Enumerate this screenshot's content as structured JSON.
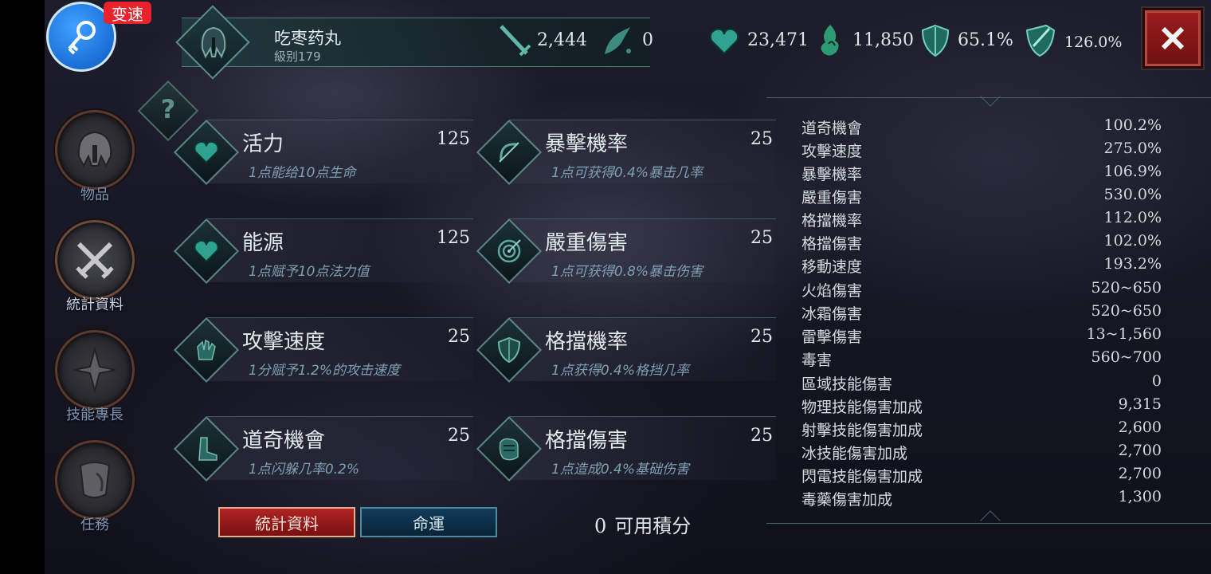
{
  "speed_badge": "变速",
  "nav": [
    {
      "label": "物品",
      "icon": "helmet-icon"
    },
    {
      "label": "統計資料",
      "icon": "crossed-swords-icon"
    },
    {
      "label": "技能專長",
      "icon": "skill-star-icon"
    },
    {
      "label": "任務",
      "icon": "quest-scroll-icon"
    }
  ],
  "header": {
    "name": "吃枣药丸",
    "level": "級别179",
    "damage": "2,444",
    "secondary": "0",
    "health": "23,471",
    "mana": "11,850",
    "armor": "65.1%",
    "resist": "126.0%"
  },
  "attributes": [
    {
      "name": "活力",
      "value": "125",
      "desc": "1点能给10点生命",
      "icon": "heart-icon"
    },
    {
      "name": "能源",
      "value": "125",
      "desc": "1点赋予10点法力值",
      "icon": "heart-icon"
    },
    {
      "name": "攻擊速度",
      "value": "25",
      "desc": "1分赋予1.2%的攻击速度",
      "icon": "gauntlet-icon"
    },
    {
      "name": "道奇機會",
      "value": "25",
      "desc": "1点闪躲几率0.2%",
      "icon": "boot-icon"
    },
    {
      "name": "暴擊機率",
      "value": "25",
      "desc": "1点可获得0.4%暴击几率",
      "icon": "bow-icon"
    },
    {
      "name": "嚴重傷害",
      "value": "25",
      "desc": "1点可获得0.8%暴击伤害",
      "icon": "target-icon"
    },
    {
      "name": "格擋機率",
      "value": "25",
      "desc": "1点获得0.4%格挡几率",
      "icon": "shield-icon"
    },
    {
      "name": "格擋傷害",
      "value": "25",
      "desc": "1点造成0.4%基础伤害",
      "icon": "fist-icon"
    }
  ],
  "stats": [
    {
      "label": "道奇機會",
      "value": "100.2%"
    },
    {
      "label": "攻擊速度",
      "value": "275.0%"
    },
    {
      "label": "暴擊機率",
      "value": "106.9%"
    },
    {
      "label": "嚴重傷害",
      "value": "530.0%"
    },
    {
      "label": "格擋機率",
      "value": "112.0%"
    },
    {
      "label": "格擋傷害",
      "value": "102.0%"
    },
    {
      "label": "移動速度",
      "value": "193.2%"
    },
    {
      "label": "火焰傷害",
      "value": "520~650"
    },
    {
      "label": "冰霜傷害",
      "value": "520~650"
    },
    {
      "label": "雷擊傷害",
      "value": "13~1,560"
    },
    {
      "label": "毒害",
      "value": "560~700"
    },
    {
      "label": "區域技能傷害",
      "value": "0"
    },
    {
      "label": "物理技能傷害加成",
      "value": "9,315"
    },
    {
      "label": "射擊技能傷害加成",
      "value": "2,600"
    },
    {
      "label": "冰技能傷害加成",
      "value": "2,700"
    },
    {
      "label": "閃電技能傷害加成",
      "value": "2,700"
    },
    {
      "label": "毒藥傷害加成",
      "value": "1,300"
    }
  ],
  "tabs": {
    "stats": "統計資料",
    "fate": "命運"
  },
  "points": {
    "value": "0",
    "label": "可用積分"
  },
  "help": "?",
  "colors": {
    "accent": "#5f8e8c",
    "tab_active": "#b02424",
    "tab_inactive": "#0f3c5a",
    "close": "#9c1d1d"
  }
}
